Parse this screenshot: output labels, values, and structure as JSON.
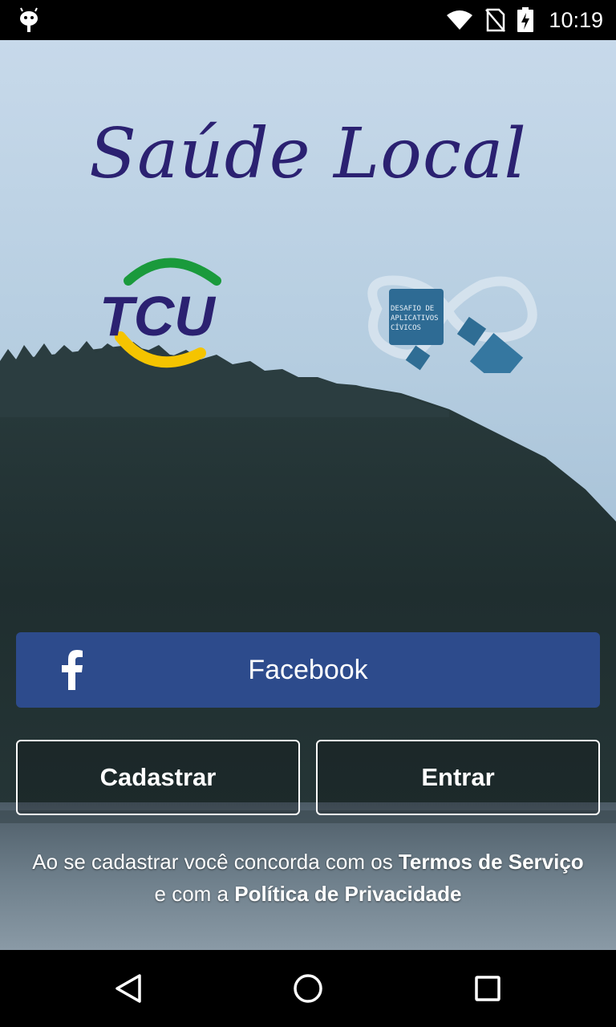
{
  "status_bar": {
    "time": "10:19",
    "icons": [
      "android-debug-icon",
      "wifi-icon",
      "no-sim-icon",
      "battery-charging-icon"
    ]
  },
  "app": {
    "title": "Saúde Local",
    "logos": {
      "left": "TCU",
      "right": [
        "DESAFIO DE",
        "APLICATIVOS",
        "CÍVICOS"
      ]
    }
  },
  "buttons": {
    "facebook_label": "Facebook",
    "register_label": "Cadastrar",
    "login_label": "Entrar"
  },
  "terms": {
    "line1_prefix": "Ao se cadastrar você concorda com os ",
    "terms_link": "Termos de Serviço",
    "line2_prefix": "e com a ",
    "privacy_link": "Política de Privacidade"
  },
  "colors": {
    "title": "#2b2171",
    "facebook": "#2d4b8c"
  }
}
